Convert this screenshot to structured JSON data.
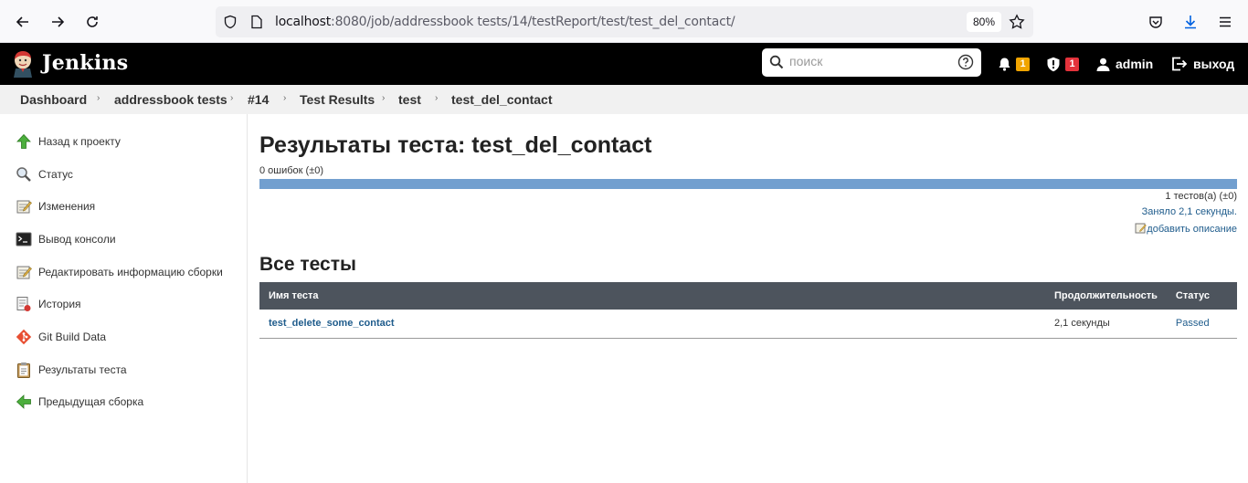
{
  "browser": {
    "url_host": "localhost",
    "url_path": ":8080/job/addressbook tests/14/testReport/test/test_del_contact/",
    "zoom": "80%"
  },
  "header": {
    "title": "Jenkins",
    "search_placeholder": "поиск",
    "notifications_count": "1",
    "security_count": "1",
    "user": "admin",
    "logout": "выход",
    "colors": {
      "notification_badge": "#f0a400",
      "security_badge": "#e3323b"
    }
  },
  "breadcrumbs": [
    "Dashboard",
    "addressbook tests",
    "#14",
    "Test Results",
    "test",
    "test_del_contact"
  ],
  "sidebar": {
    "items": [
      {
        "label": "Назад к проекту",
        "icon": "up-arrow-icon"
      },
      {
        "label": "Статус",
        "icon": "magnifier-icon"
      },
      {
        "label": "Изменения",
        "icon": "notepad-icon"
      },
      {
        "label": "Вывод консоли",
        "icon": "terminal-icon"
      },
      {
        "label": "Редактировать информацию сборки",
        "icon": "notepad-icon"
      },
      {
        "label": "История",
        "icon": "history-icon"
      },
      {
        "label": "Git Build Data",
        "icon": "git-icon"
      },
      {
        "label": "Результаты теста",
        "icon": "clipboard-icon"
      },
      {
        "label": "Предыдущая сборка",
        "icon": "left-arrow-icon"
      }
    ]
  },
  "main": {
    "title": "Результаты теста: test_del_contact",
    "failures": "0 ошибок (±0)",
    "pass_fraction": 1.0,
    "tests_count": "1 тестов(а) (±0)",
    "duration": "Заняло 2,1 секунды.",
    "add_description": "добавить описание",
    "all_tests_heading": "Все тесты",
    "table": {
      "headers": [
        "Имя теста",
        "Продолжительность",
        "Статус"
      ],
      "rows": [
        {
          "name": "test_delete_some_contact",
          "duration": "2,1 секунды",
          "status": "Passed"
        }
      ]
    }
  }
}
